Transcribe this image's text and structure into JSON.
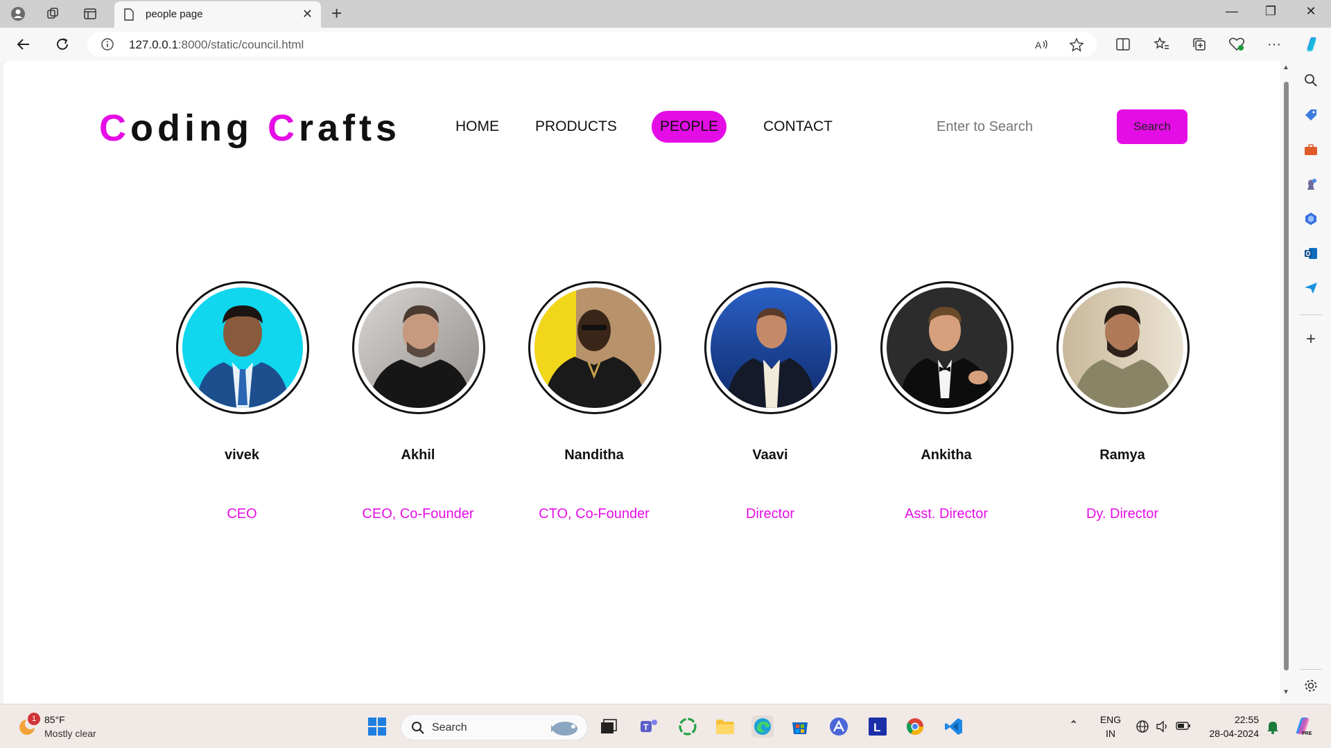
{
  "browser": {
    "tab_title": "people page",
    "url_host": "127.0.0.1",
    "url_path": ":8000/static/council.html"
  },
  "site": {
    "logo_c1": "C",
    "logo_rest1": "oding ",
    "logo_c2": "C",
    "logo_rest2": "rafts",
    "accent_color": "#e50de5",
    "nav": [
      {
        "label": "HOME"
      },
      {
        "label": "PRODUCTS"
      },
      {
        "label": "PEOPLE",
        "active": true
      },
      {
        "label": "CONTACT"
      }
    ],
    "search_placeholder": "Enter to Search",
    "search_button": "Search"
  },
  "people": [
    {
      "name": "vivek",
      "role": "CEO"
    },
    {
      "name": "Akhil",
      "role": "CEO, Co-Founder"
    },
    {
      "name": "Nanditha",
      "role": "CTO, Co-Founder"
    },
    {
      "name": "Vaavi",
      "role": "Director"
    },
    {
      "name": "Ankitha",
      "role": "Asst. Director"
    },
    {
      "name": "Ramya",
      "role": "Dy. Director"
    }
  ],
  "taskbar": {
    "weather_temp": "85°F",
    "weather_desc": "Mostly clear",
    "weather_badge": "1",
    "search_label": "Search",
    "lang_top": "ENG",
    "lang_bottom": "IN",
    "time": "22:55",
    "date": "28-04-2024"
  }
}
